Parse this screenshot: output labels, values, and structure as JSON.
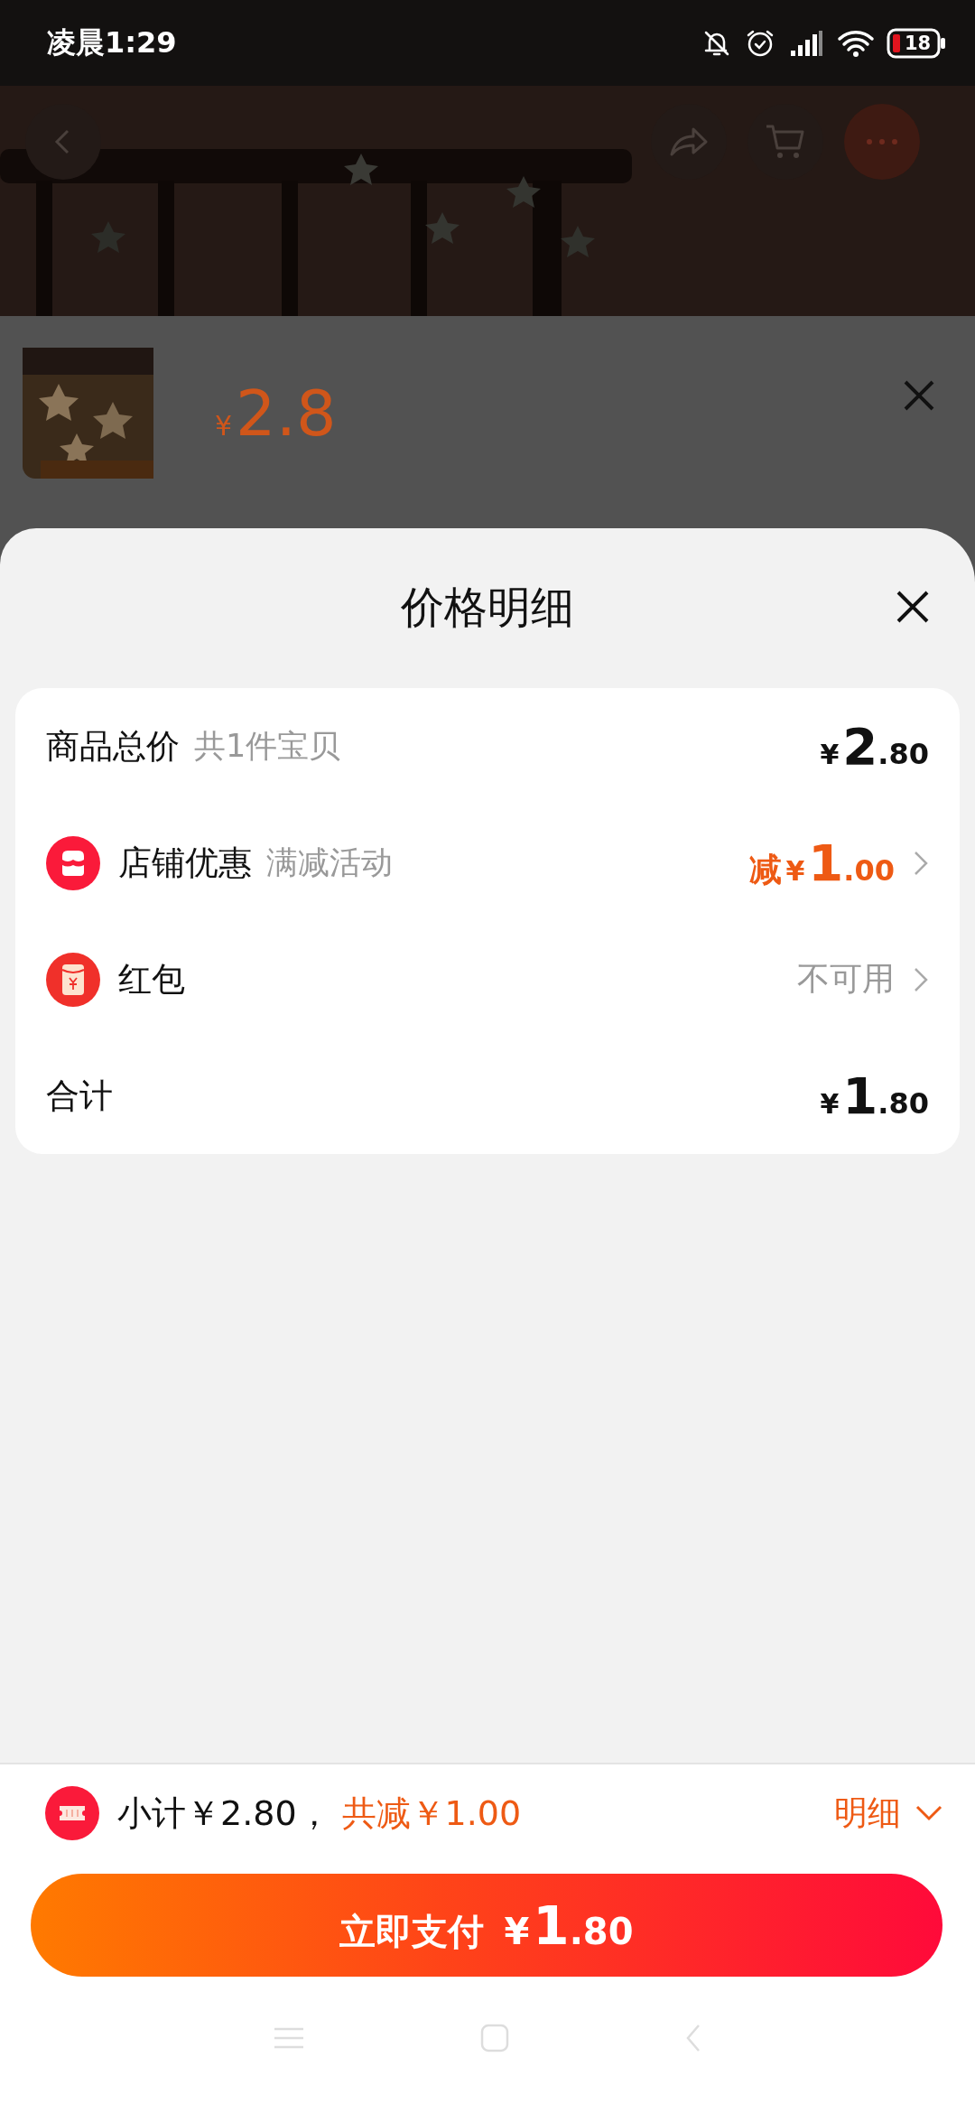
{
  "status_bar": {
    "time": "凌晨1:29",
    "battery": "18"
  },
  "product_header": {
    "price": {
      "currency": "¥",
      "amount": "2.8"
    }
  },
  "sheet": {
    "title": "价格明细",
    "rows": [
      {
        "kind": "plain",
        "label": "商品总价",
        "note": "共1件宝贝",
        "price": {
          "currency": "¥",
          "integer": "2",
          "decimals": ".80"
        }
      },
      {
        "kind": "shop_discount",
        "label": "店铺优惠",
        "note": "满减活动",
        "price": {
          "prefix": "减",
          "currency": "¥",
          "integer": "1",
          "decimals": ".00"
        }
      },
      {
        "kind": "red_packet",
        "label": "红包",
        "value": "不可用"
      },
      {
        "kind": "plain",
        "label": "合计",
        "price": {
          "currency": "¥",
          "integer": "1",
          "decimals": ".80"
        }
      }
    ]
  },
  "footer": {
    "subtotal": "小计￥2.80，",
    "discount": "共减￥1.00",
    "details_link": "明细",
    "pay_button": {
      "label": "立即支付",
      "price": {
        "currency": "¥",
        "integer": "1",
        "decimals": ".80"
      }
    }
  }
}
